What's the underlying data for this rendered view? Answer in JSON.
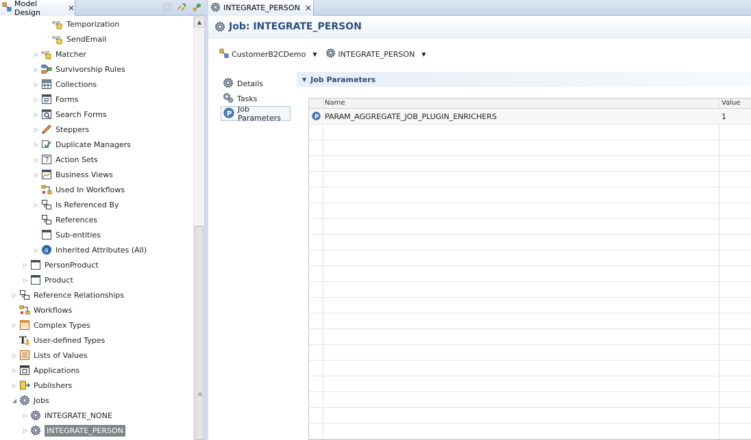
{
  "left_view": {
    "tab_label": "Model Design",
    "tree": [
      {
        "label": "Temporization",
        "icon": "xyz-attribute-icon",
        "expandable": false
      },
      {
        "label": "SendEmail",
        "icon": "xyz-attribute-icon",
        "expandable": false
      },
      {
        "label": "Matcher",
        "icon": "matcher-icon",
        "expandable": true
      },
      {
        "label": "Survivorship Rules",
        "icon": "survivorship-icon",
        "expandable": true
      },
      {
        "label": "Collections",
        "icon": "table-icon",
        "expandable": true
      },
      {
        "label": "Forms",
        "icon": "form-icon",
        "expandable": true
      },
      {
        "label": "Search Forms",
        "icon": "search-form-icon",
        "expandable": true
      },
      {
        "label": "Steppers",
        "icon": "pencil-icon",
        "expandable": true
      },
      {
        "label": "Duplicate Managers",
        "icon": "duplicate-icon",
        "expandable": true
      },
      {
        "label": "Action Sets",
        "icon": "action-set-icon",
        "expandable": true
      },
      {
        "label": "Business Views",
        "icon": "business-view-icon",
        "expandable": true
      },
      {
        "label": "Used In Workflows",
        "icon": "workflow-icon",
        "expandable": false
      },
      {
        "label": "Is Referenced By",
        "icon": "reference-icon",
        "expandable": true
      },
      {
        "label": "References",
        "icon": "reference-icon",
        "expandable": false
      },
      {
        "label": "Sub-entities",
        "icon": "entity-icon",
        "expandable": false
      },
      {
        "label": "Inherited Attributes (All)",
        "icon": "attribute-a-icon",
        "expandable": true
      },
      {
        "label": "PersonProduct",
        "icon": "entity-icon",
        "expandable": true
      },
      {
        "label": "Product",
        "icon": "entity-icon",
        "expandable": true
      },
      {
        "label": "Reference Relationships",
        "icon": "reference-icon",
        "expandable": true
      },
      {
        "label": "Workflows",
        "icon": "workflow-icon",
        "expandable": false
      },
      {
        "label": "Complex Types",
        "icon": "complex-type-icon",
        "expandable": true
      },
      {
        "label": "User-defined Types",
        "icon": "user-type-icon",
        "expandable": false
      },
      {
        "label": "Lists of Values",
        "icon": "list-icon",
        "expandable": true
      },
      {
        "label": "Applications",
        "icon": "application-icon",
        "expandable": true
      },
      {
        "label": "Publishers",
        "icon": "publisher-icon",
        "expandable": true
      },
      {
        "label": "Jobs",
        "icon": "gear-icon",
        "expandable": true,
        "expanded": true
      },
      {
        "label": "INTEGRATE_NONE",
        "icon": "gear-icon",
        "expandable": true
      },
      {
        "label": "INTEGRATE_PERSON",
        "icon": "gear-icon",
        "expandable": true,
        "selected": true
      }
    ]
  },
  "editor": {
    "tab_label": "INTEGRATE_PERSON",
    "title": "Job: INTEGRATE_PERSON",
    "breadcrumb": {
      "model": "CustomerB2CDemo",
      "job": "INTEGRATE_PERSON"
    },
    "nav": [
      {
        "label": "Details",
        "icon": "gear-icon"
      },
      {
        "label": "Tasks",
        "icon": "gears-icon"
      },
      {
        "label": "Job Parameters",
        "icon": "parameter-icon",
        "active": true
      }
    ],
    "section_title": "Job Parameters",
    "table": {
      "columns": [
        "Name",
        "Value"
      ],
      "rows": [
        {
          "name": "PARAM_AGGREGATE_JOB_PLUGIN_ENRICHERS",
          "value": "1"
        }
      ]
    }
  },
  "colors": {
    "accent": "#2a4f80",
    "selection": "#7f8486",
    "tab_bg": "#dbe6f3"
  }
}
